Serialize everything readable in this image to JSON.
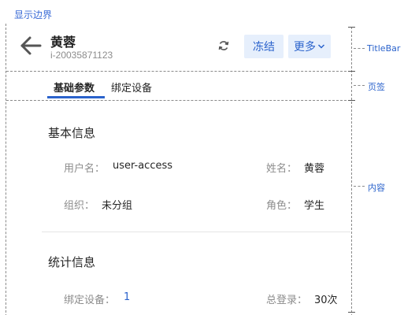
{
  "boundary_toggle": "显示边界",
  "titlebar": {
    "name": "黄蓉",
    "id": "i-20035871123",
    "freeze_label": "冻结",
    "more_label": "更多"
  },
  "tabs": [
    {
      "label": "基础参数",
      "active": true
    },
    {
      "label": "绑定设备",
      "active": false
    }
  ],
  "basic_info": {
    "title": "基本信息",
    "fields": [
      {
        "label": "用户名：",
        "value": "user-access"
      },
      {
        "label": "姓名：",
        "value": "黄蓉"
      },
      {
        "label": "组织：",
        "value": "未分组"
      },
      {
        "label": "角色：",
        "value": "学生"
      }
    ]
  },
  "stats_info": {
    "title": "统计信息",
    "fields": [
      {
        "label": "绑定设备：",
        "value": "1"
      },
      {
        "label": "总登录：",
        "value": "30次"
      }
    ]
  },
  "annotations": {
    "titlebar": "TitleBar",
    "tabs": "页签",
    "content": "内容"
  },
  "colors": {
    "accent": "#2b63cc",
    "button_bg": "#e6effc",
    "muted_text": "#8c8c8c"
  }
}
